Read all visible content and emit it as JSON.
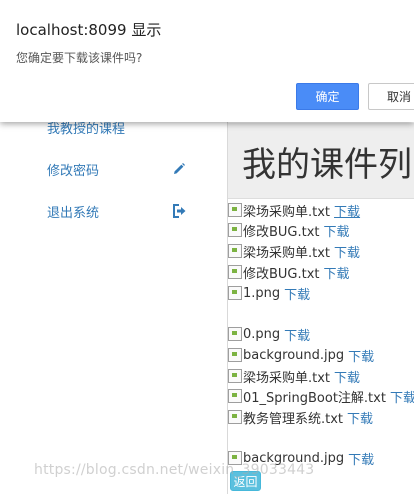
{
  "dialog": {
    "title": "localhost:8099 显示",
    "message": "您确定要下载该课件吗?",
    "ok_label": "确定",
    "cancel_label": "取消"
  },
  "sidebar": {
    "items": [
      {
        "label": "我教授的课程",
        "icon": ""
      },
      {
        "label": "修改密码",
        "icon": "pencil-icon"
      },
      {
        "label": "退出系统",
        "icon": "logout-icon"
      }
    ]
  },
  "main": {
    "title": "我的课件列",
    "download_label": "下载",
    "files": [
      "梁场采购单.txt",
      "修改BUG.txt",
      "梁场采购单.txt",
      "修改BUG.txt",
      "1.png",
      "0.png",
      "background.jpg",
      "梁场采购单.txt",
      "01_SpringBoot注解.txt",
      "教务管理系统.txt",
      "background.jpg"
    ],
    "back_label": "返回"
  },
  "watermark": "https://blog.csdn.net/weixin_39033443",
  "colors": {
    "link": "#337ab7",
    "primary_button": "#4a8cf7",
    "info_button": "#5bc0de"
  }
}
